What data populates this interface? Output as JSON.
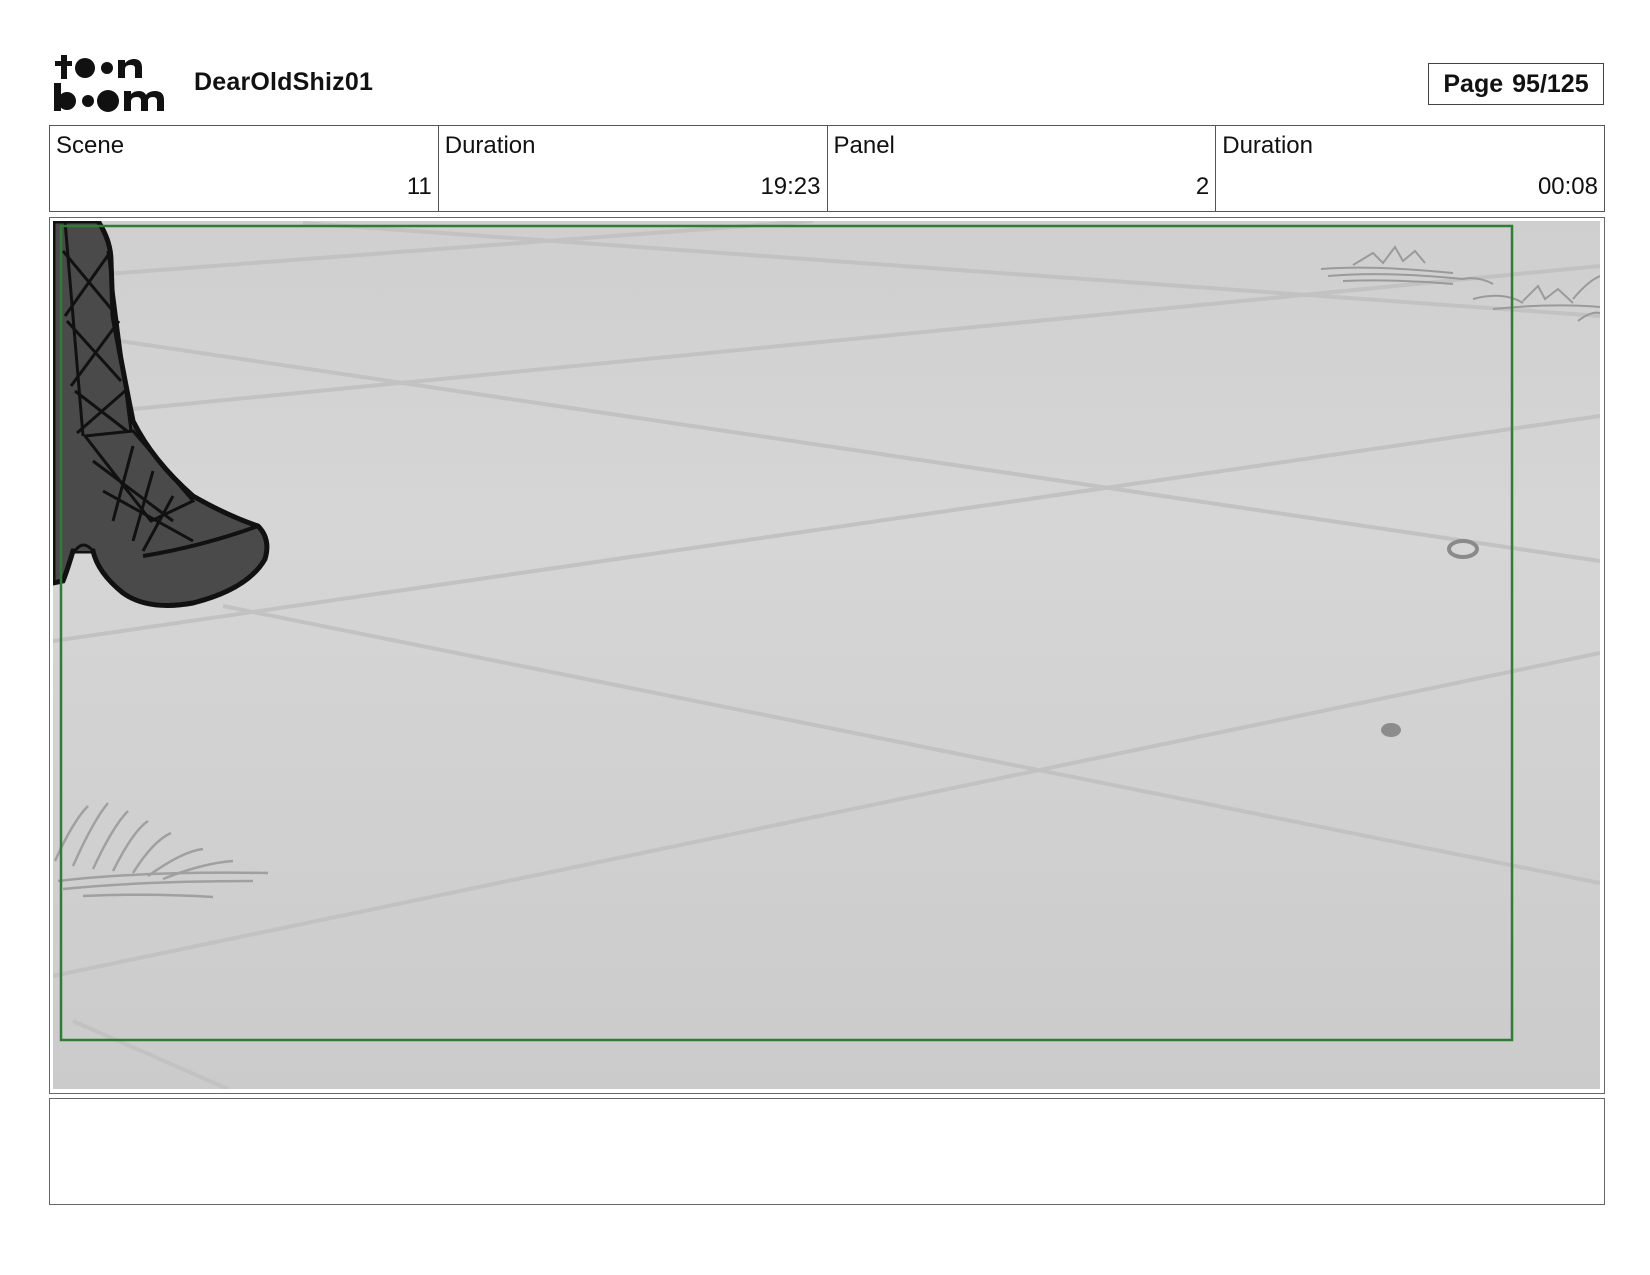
{
  "header": {
    "logo_icon": "toonboom-logo",
    "project_title": "DearOldShiz01",
    "page_label": "Page",
    "page_number": "95/125"
  },
  "info": {
    "scene_label": "Scene",
    "scene_value": "11",
    "scene_duration_label": "Duration",
    "scene_duration_value": "19:23",
    "panel_label": "Panel",
    "panel_value": "2",
    "panel_duration_label": "Duration",
    "panel_duration_value": "00:08"
  },
  "panel": {
    "safe_frame_color": "#2e7d32",
    "floor_color": "#d4d4d4",
    "boot_color": "#4a4a4a"
  },
  "caption": {
    "text": ""
  }
}
